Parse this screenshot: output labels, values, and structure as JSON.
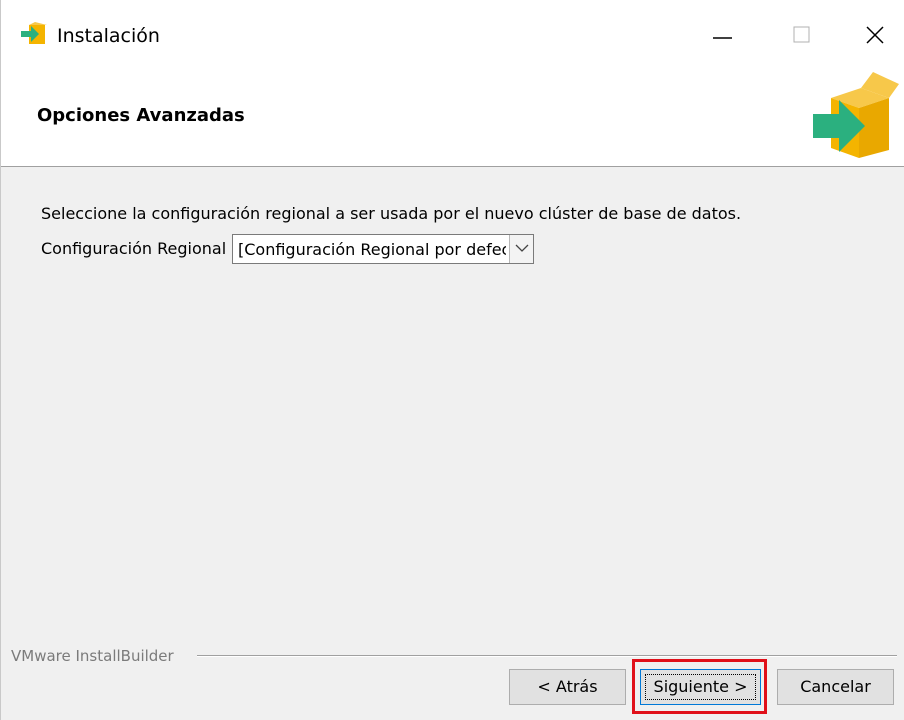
{
  "window": {
    "title": "Instalación",
    "icon": "installer-box-arrow-icon"
  },
  "header": {
    "title": "Opciones Avanzadas",
    "logo_icon": "installer-box-arrow-icon"
  },
  "content": {
    "instruction": "Seleccione la configuración regional a ser usada por el nuevo clúster de base de datos.",
    "locale_label": "Configuración Regional",
    "locale_value": "[Configuración Regional por defecto]"
  },
  "footer": {
    "brand": "VMware InstallBuilder",
    "back_label": "< Atrás",
    "next_label": "Siguiente >",
    "cancel_label": "Cancelar"
  },
  "colors": {
    "highlight": "#e0101a",
    "box_orange": "#f4b400",
    "arrow_green": "#2bb07f"
  }
}
